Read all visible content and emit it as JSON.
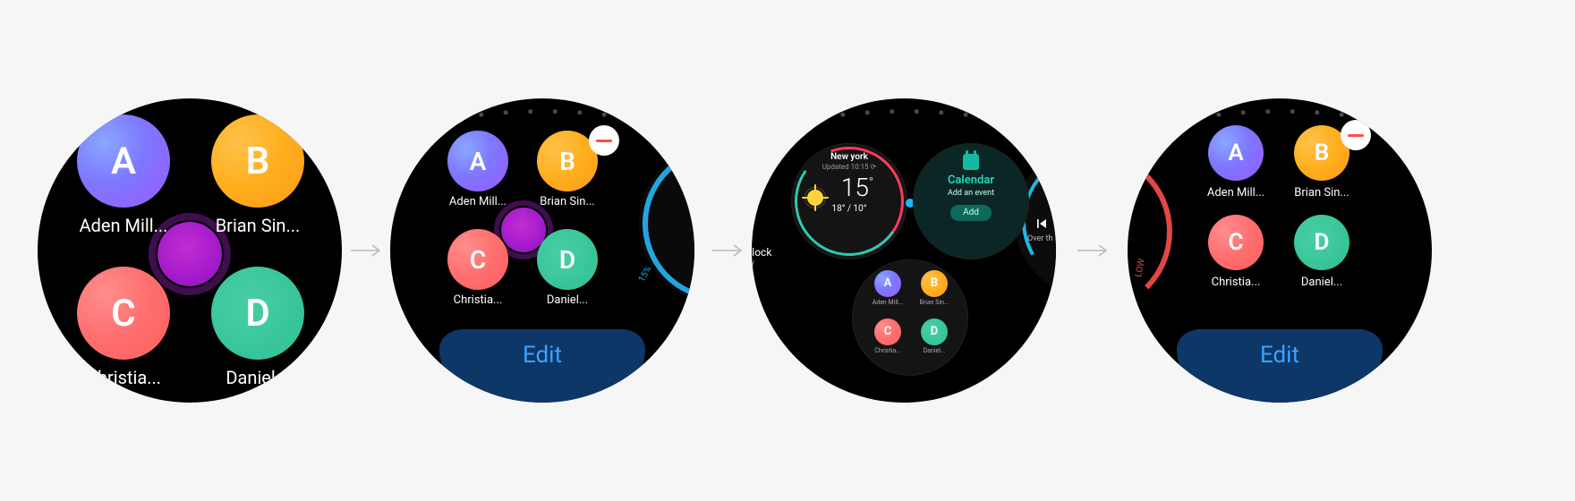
{
  "contacts": {
    "a": {
      "initial": "A",
      "name": "Aden Mill..."
    },
    "b": {
      "initial": "B",
      "name": "Brian Sin..."
    },
    "c": {
      "initial": "C",
      "name": "Christia..."
    },
    "d": {
      "initial": "D",
      "name": "Daniel..."
    }
  },
  "buttons": {
    "edit": "Edit",
    "add": "Add"
  },
  "calendar": {
    "title": "Calendar",
    "subtitle": "Add an event"
  },
  "weather": {
    "city": "New york",
    "updated": "Updated 10:15  ⟳",
    "temp": "15",
    "hi": "18°",
    "lo": "10°"
  },
  "clock_peek": {
    "title": "clock",
    "sub": "ity"
  },
  "music_peek": {
    "line": "Over th"
  },
  "ring_peek": {
    "percent": "15%"
  },
  "low_label": "LOW",
  "dots": {
    "total": 22,
    "active_w2": 3,
    "active_w3": 7,
    "active_w4": 3
  }
}
